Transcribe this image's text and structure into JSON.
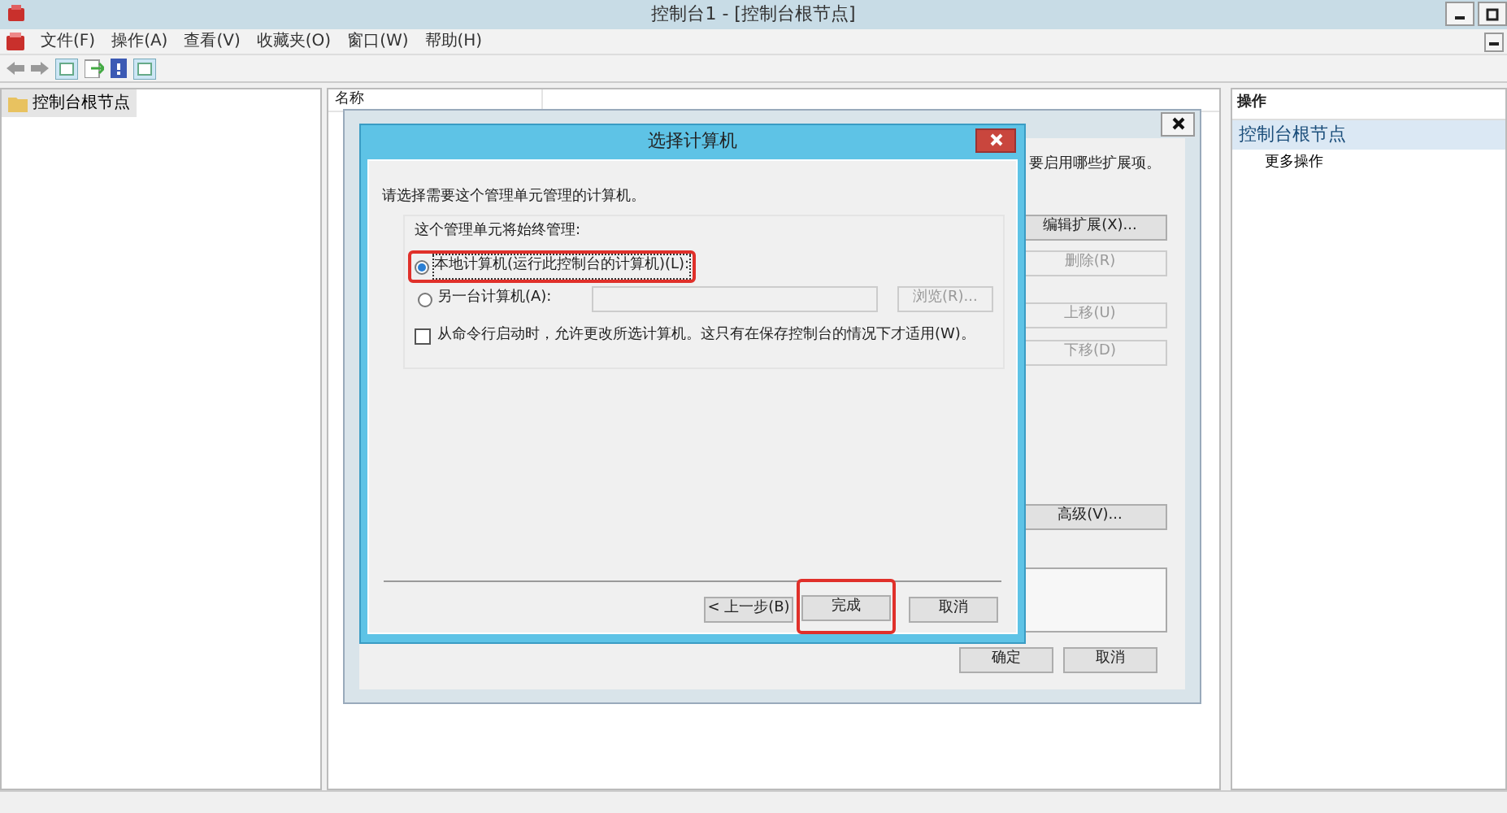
{
  "window": {
    "title": "控制台1 - [控制台根节点]"
  },
  "menu": [
    "文件(F)",
    "操作(A)",
    "查看(V)",
    "收藏夹(O)",
    "窗口(W)",
    "帮助(H)"
  ],
  "tree": [
    {
      "label": "控制台根节点",
      "selected": true
    }
  ],
  "center": {
    "columns": [
      "名称"
    ]
  },
  "actions": {
    "header": "操作",
    "items": [
      {
        "label": "控制台根节点",
        "kind": "section",
        "selected": true
      },
      {
        "label": "更多操作",
        "kind": "item",
        "selected": false
      }
    ]
  },
  "back_dialog": {
    "text": "要启用哪些扩展项。",
    "side_buttons": [
      {
        "label": "编辑扩展(X)...",
        "disabled": false
      },
      {
        "label": "删除(R)",
        "disabled": true
      },
      {
        "label": "上移(U)",
        "disabled": true
      },
      {
        "label": "下移(D)",
        "disabled": true
      },
      {
        "label": "高级(V)...",
        "disabled": false
      }
    ],
    "buttons": [
      {
        "label": "确定",
        "disabled": false
      },
      {
        "label": "取消",
        "disabled": false
      }
    ]
  },
  "dialog": {
    "title": "选择计算机",
    "prompt": "请选择需要这个管理单元管理的计算机。",
    "group_label": "这个管理单元将始终管理:",
    "options": [
      {
        "label": "本地计算机(运行此控制台的计算机)(L):",
        "selected": true,
        "highlighted": true
      },
      {
        "label": "另一台计算机(A):",
        "selected": false,
        "highlighted": false
      }
    ],
    "browse_button": {
      "label": "浏览(R)...",
      "disabled": true
    },
    "checkbox": {
      "label": "从命令行启动时，允许更改所选计算机。这只有在保存控制台的情况下才适用(W)。",
      "checked": false
    },
    "buttons": [
      {
        "label": "< 上一步(B)",
        "highlighted": false
      },
      {
        "label": "完成",
        "highlighted": true
      },
      {
        "label": "取消",
        "highlighted": false
      }
    ]
  }
}
